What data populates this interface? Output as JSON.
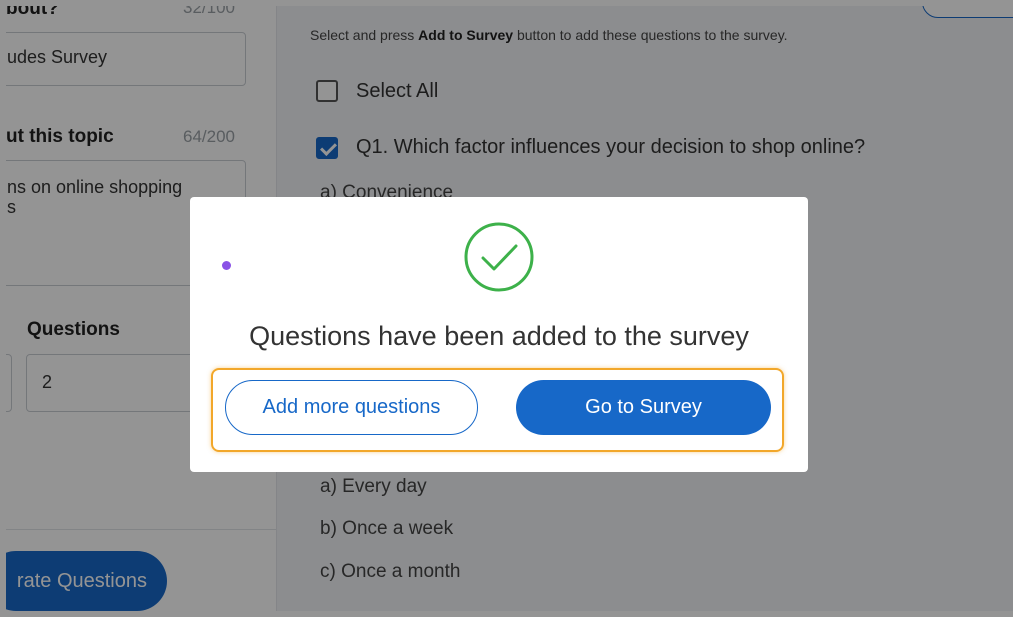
{
  "colors": {
    "accent": "#1768c8",
    "success": "#3db14a",
    "focus": "#f2a72a",
    "dot": "#8a52e6"
  },
  "left_panel": {
    "about_label": "bout?",
    "about_count": "32/100",
    "about_value": "udes Survey",
    "topic_label": "ut this topic",
    "topic_count": "64/200",
    "topic_value_line1": "ns on online shopping",
    "topic_value_line2": "s",
    "questions_label": "Questions",
    "questions_value": "2",
    "generate_button": "rate Questions"
  },
  "right_panel": {
    "instruction_prefix": "Select and press ",
    "instruction_bold": "Add to Survey",
    "instruction_suffix": " button to add these questions to the survey.",
    "select_all": "Select All",
    "select_all_checked": false,
    "q1_text": "Q1. Which factor influences your decision to shop online?",
    "q1_checked": true,
    "q1_option_a": "a) Convenience",
    "q2_options": [
      "a) Every day",
      "b) Once a week",
      "c) Once a month"
    ]
  },
  "modal": {
    "message": "Questions have been added to the survey",
    "add_more_label": "Add more questions",
    "go_to_survey_label": "Go to Survey",
    "icon": "check-circle-icon"
  }
}
